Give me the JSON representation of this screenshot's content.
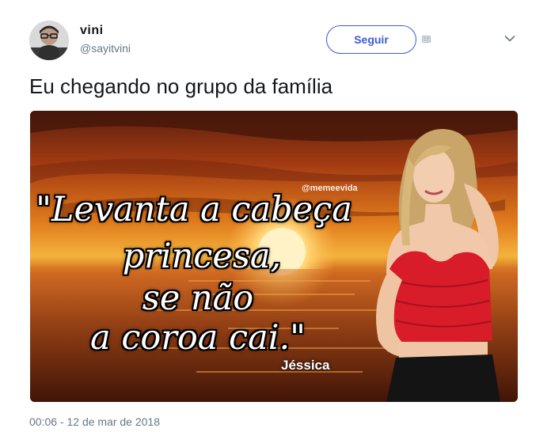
{
  "author": {
    "display_name": "vini",
    "handle": "@sayitvini",
    "avatar_icon": "user-avatar-icon"
  },
  "actions": {
    "follow_label": "Seguir",
    "follow_aux_icon": "follow-aux-icon",
    "more_icon": "chevron-down-icon"
  },
  "tweet": {
    "text": "Eu chegando no grupo da família",
    "timestamp": "00:06 - 12 de mar de 2018"
  },
  "media": {
    "watermark": "@memeevida",
    "quote_lines": [
      "\"Levanta a cabeça",
      "princesa,",
      "se não",
      "a coroa cai.\""
    ],
    "signature": "Jéssica"
  },
  "colors": {
    "accent": "#3b5bd8",
    "text": "#14171a",
    "muted": "#657786",
    "top_dress": "#d81c2a"
  }
}
